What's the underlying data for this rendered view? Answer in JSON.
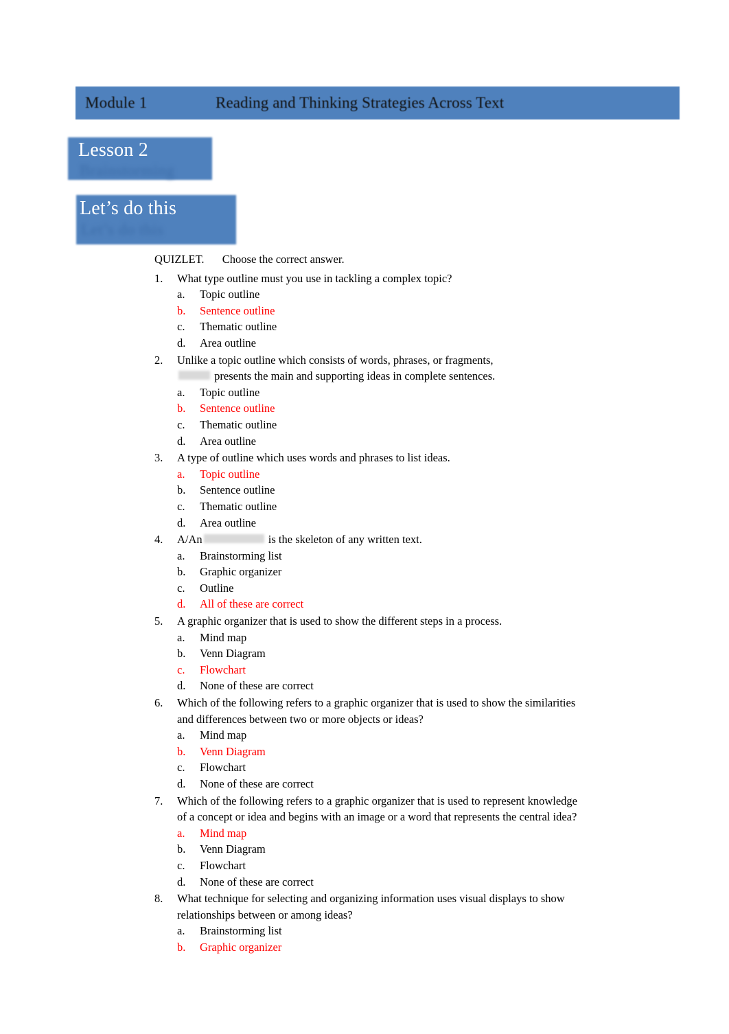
{
  "header": {
    "module_label": "Module 1",
    "module_title": "Reading and Thinking Strategies Across Text"
  },
  "lesson": {
    "title": "Lesson 2",
    "subtitle_blurred": "Brainstorming"
  },
  "activity": {
    "title": "Let’s do this",
    "subtitle_blurred": "Let’s do this"
  },
  "quiz": {
    "intro_label": "QUIZLET.",
    "intro_instruction": "Choose the correct answer.",
    "correct_color": "#ff0000",
    "items": [
      {
        "number": "1.",
        "text": "What type outline must you use in tackling a complex topic?",
        "justify": false,
        "options": [
          {
            "letter": "a.",
            "label": "Topic outline",
            "correct": false
          },
          {
            "letter": "b.",
            "label": "Sentence outline",
            "correct": true
          },
          {
            "letter": "c.",
            "label": "Thematic outline",
            "correct": false
          },
          {
            "letter": "d.",
            "label": "Area outline",
            "correct": false
          }
        ]
      },
      {
        "number": "2.",
        "text_before": "Unlike a topic outline which consists of words, phrases, or fragments,",
        "text_after": "presents the main and supporting ideas in complete sentences.",
        "has_blank_line2": true,
        "justify": false,
        "options": [
          {
            "letter": "a.",
            "label": "Topic outline",
            "correct": false
          },
          {
            "letter": "b.",
            "label": "Sentence outline",
            "correct": true
          },
          {
            "letter": "c.",
            "label": "Thematic outline",
            "correct": false
          },
          {
            "letter": "d.",
            "label": "Area outline",
            "correct": false
          }
        ]
      },
      {
        "number": "3.",
        "text": "A type of outline which uses words and phrases to list ideas.",
        "justify": false,
        "options": [
          {
            "letter": "a.",
            "label": "Topic outline",
            "correct": true
          },
          {
            "letter": "b.",
            "label": "Sentence outline",
            "correct": false
          },
          {
            "letter": "c.",
            "label": "Thematic outline",
            "correct": false
          },
          {
            "letter": "d.",
            "label": "Area outline",
            "correct": false
          }
        ]
      },
      {
        "number": "4.",
        "text_before": "A/An",
        "text_after": "is the skeleton of any written text.",
        "has_blank_inline": true,
        "justify": false,
        "options": [
          {
            "letter": "a.",
            "label": "Brainstorming list",
            "correct": false
          },
          {
            "letter": "b.",
            "label": "Graphic organizer",
            "correct": false
          },
          {
            "letter": "c.",
            "label": "Outline",
            "correct": false
          },
          {
            "letter": "d.",
            "label": "All of these are correct",
            "correct": true
          }
        ]
      },
      {
        "number": "5.",
        "text": "A graphic organizer that is used to show the different steps in a process.",
        "justify": false,
        "options": [
          {
            "letter": "a.",
            "label": "Mind map",
            "correct": false
          },
          {
            "letter": "b.",
            "label": "Venn Diagram",
            "correct": false
          },
          {
            "letter": "c.",
            "label": "Flowchart",
            "correct": true
          },
          {
            "letter": "d.",
            "label": "None of these are correct",
            "correct": false
          }
        ]
      },
      {
        "number": "6.",
        "text": "Which of the following refers to a graphic organizer that is used to show the similarities and differences between two or more objects or ideas?",
        "justify": false,
        "options": [
          {
            "letter": "a.",
            "label": "Mind map",
            "correct": false
          },
          {
            "letter": "b.",
            "label": "Venn Diagram",
            "correct": true
          },
          {
            "letter": "c.",
            "label": "Flowchart",
            "correct": false
          },
          {
            "letter": "d.",
            "label": "None of these are correct",
            "correct": false
          }
        ]
      },
      {
        "number": "7.",
        "text": "Which of the following refers to a graphic organizer that is used to represent knowledge of a concept or idea and begins with an image or a word that represents the central idea?",
        "justify": true,
        "options": [
          {
            "letter": "a.",
            "label": "Mind map",
            "correct": true
          },
          {
            "letter": "b.",
            "label": "Venn Diagram",
            "correct": false
          },
          {
            "letter": "c.",
            "label": "Flowchart",
            "correct": false
          },
          {
            "letter": "d.",
            "label": "None of these are correct",
            "correct": false
          }
        ]
      },
      {
        "number": "8.",
        "text": "What technique for selecting and organizing information uses visual displays to show relationships between or among ideas?",
        "justify": false,
        "options": [
          {
            "letter": "a.",
            "label": "Brainstorming list",
            "correct": false
          },
          {
            "letter": "b.",
            "label": "Graphic organizer",
            "correct": true
          }
        ]
      }
    ]
  }
}
